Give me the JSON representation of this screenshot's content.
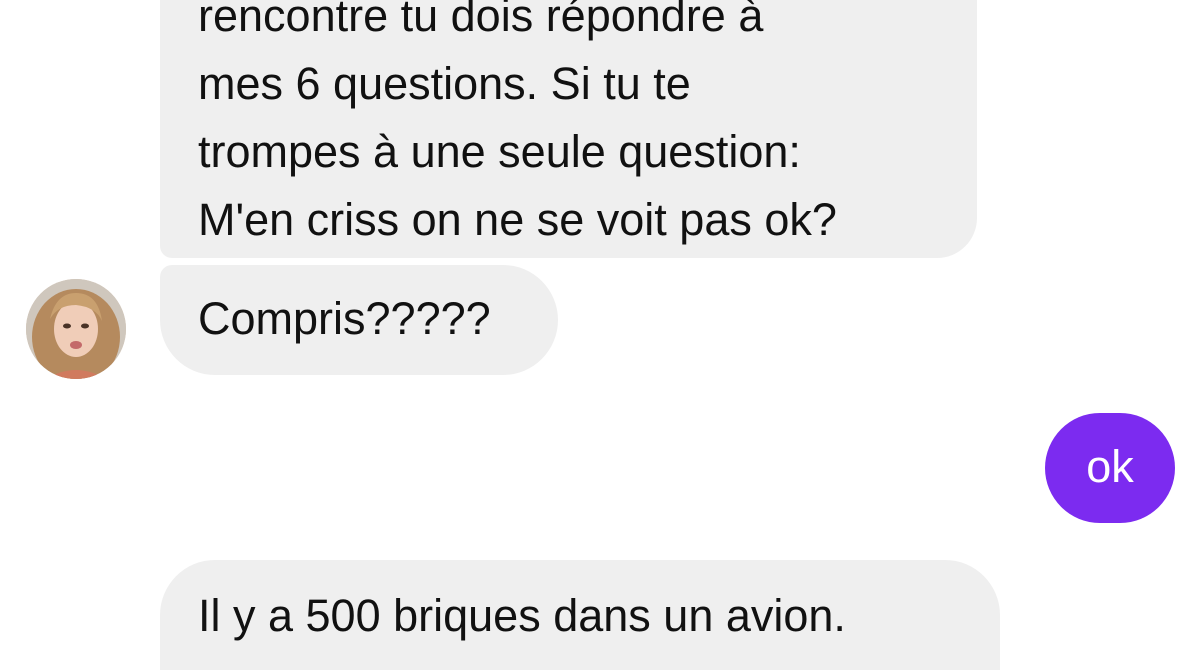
{
  "conversation": {
    "messages": [
      {
        "sender": "contact",
        "lines": [
          "rencontre tu dois répondre à",
          "mes 6 questions. Si tu te",
          "trompes à une seule question:",
          "M'en criss on ne se voit pas ok?"
        ]
      },
      {
        "sender": "contact",
        "lines": [
          "Compris?????"
        ]
      },
      {
        "sender": "me",
        "lines": [
          "ok"
        ]
      },
      {
        "sender": "contact",
        "lines": [
          "Il y a 500 briques dans un avion."
        ]
      }
    ]
  },
  "colors": {
    "received_bubble": "#efefef",
    "sent_bubble": "#7c2bf0",
    "sent_text": "#ffffff",
    "received_text": "#111111"
  },
  "icons": {
    "contact_avatar": "contact-avatar-photo"
  }
}
